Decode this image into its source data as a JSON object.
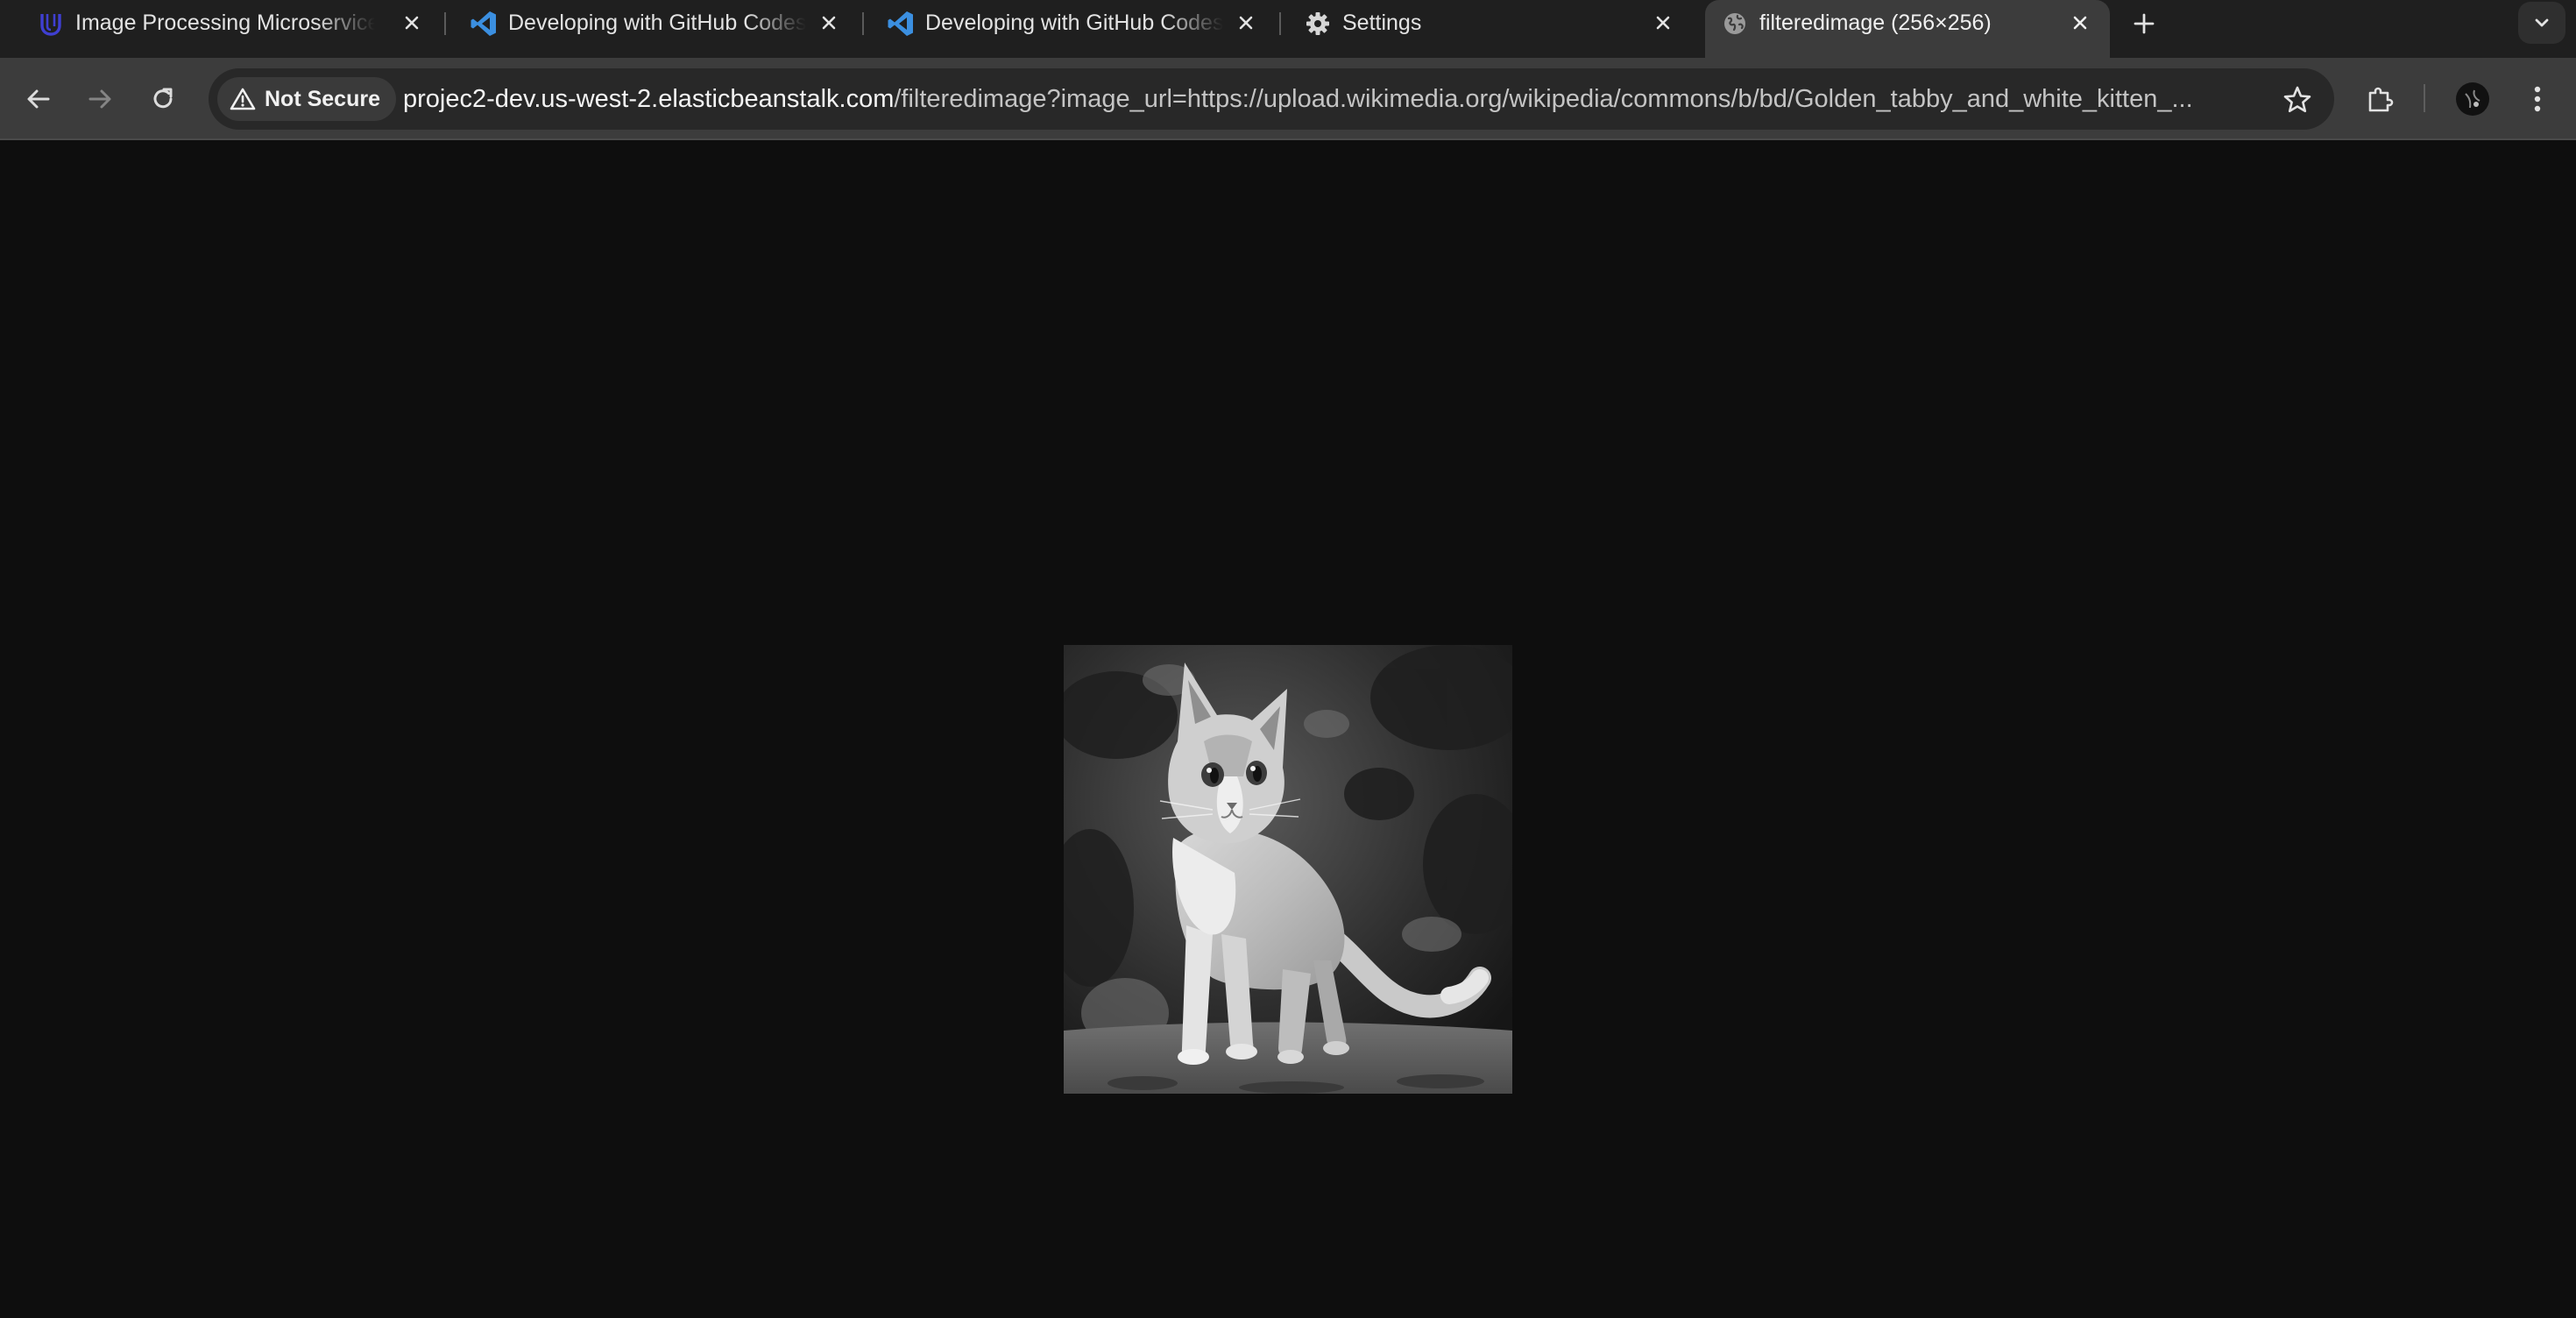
{
  "tabs": [
    {
      "title": "Image Processing Microservice",
      "icon": "udacity-icon",
      "active": false
    },
    {
      "title": "Developing with GitHub Codespaces",
      "icon": "vscode-icon",
      "active": false
    },
    {
      "title": "Developing with GitHub Codespaces",
      "icon": "vscode-icon",
      "active": false
    },
    {
      "title": "Settings",
      "icon": "gear-icon",
      "active": false
    },
    {
      "title": "filteredimage (256×256)",
      "icon": "globe-icon",
      "active": true
    }
  ],
  "toolbar": {
    "security_label": "Not Secure",
    "url_host": "projec2-dev.us-west-2.elasticbeanstalk.com",
    "url_rest": "/filteredimage?image_url=https://upload.wikimedia.org/wikipedia/commons/b/bd/Golden_tabby_and_white_kitten_..."
  },
  "content": {
    "image_alt": "Golden tabby and white kitten, grayscale filtered",
    "image_size": "256×256"
  },
  "colors": {
    "page_background": "#0e0e0e",
    "tabstrip": "#1f1f1f",
    "toolbar": "#3c3c3c",
    "omnibox": "#282828",
    "vscode_blue": "#3b8fe0",
    "udacity_blue": "#3f3fd1"
  }
}
